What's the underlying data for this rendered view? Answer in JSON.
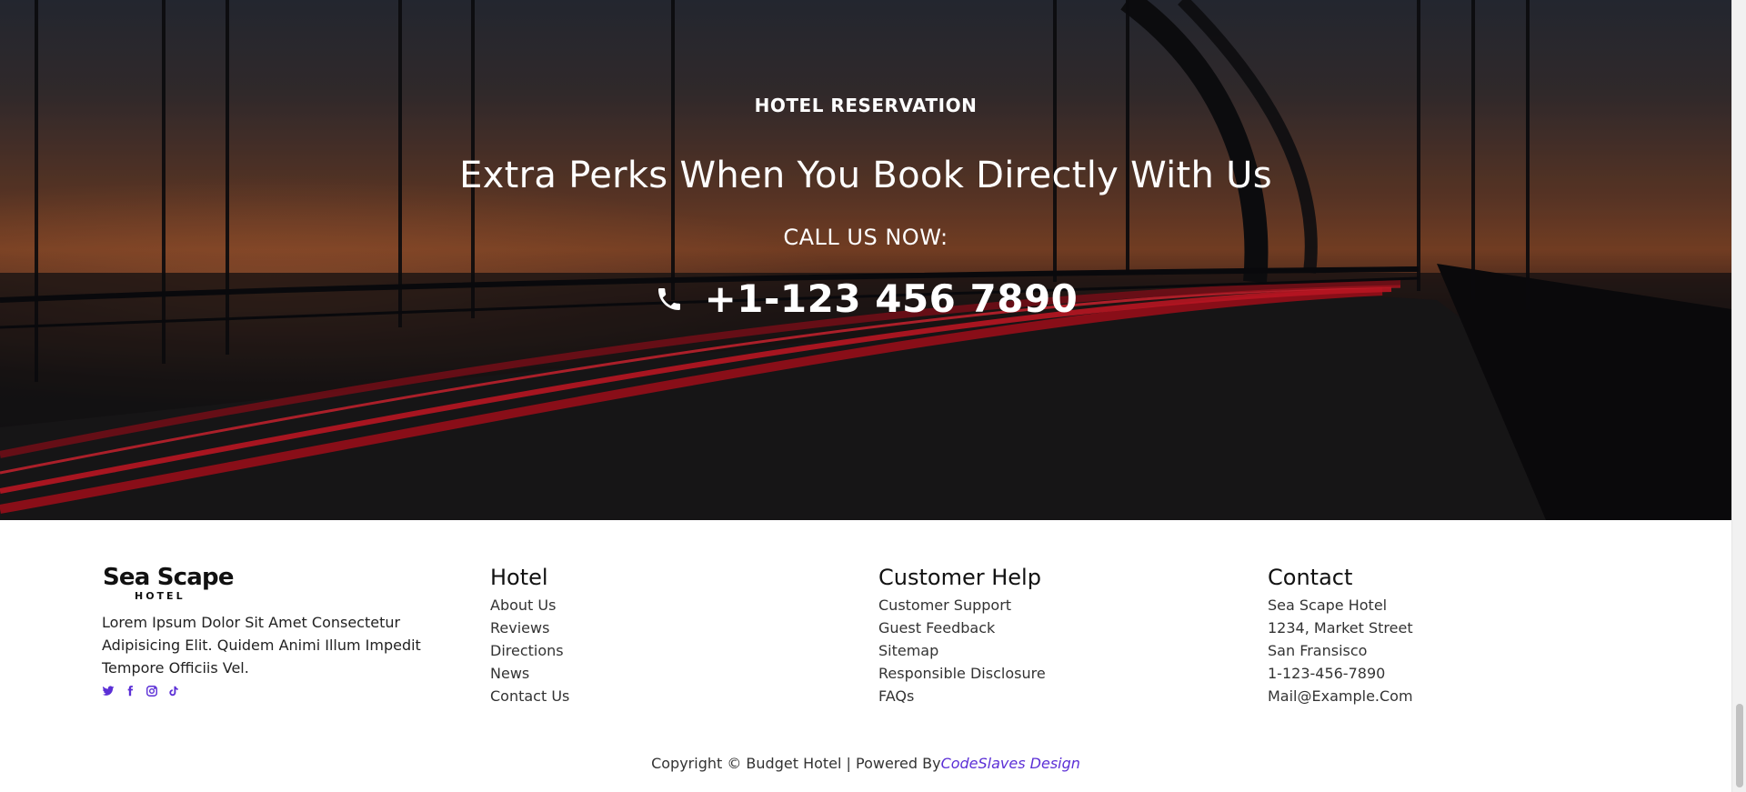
{
  "hero": {
    "eyebrow": "HOTEL RESERVATION",
    "headline": "Extra Perks When You Book Directly With Us",
    "call_label": "CALL US NOW:",
    "phone_icon": "phone-icon",
    "phone_number": "+1-123 456 7890"
  },
  "footer": {
    "brand": {
      "logo_main": "Sea Scape",
      "logo_sub": "HOTEL",
      "description": "Lorem Ipsum Dolor Sit Amet Consectetur Adipisicing Elit. Quidem Animi Illum Impedit Tempore Officiis Vel.",
      "social": [
        {
          "icon": "twitter-icon"
        },
        {
          "icon": "facebook-icon"
        },
        {
          "icon": "instagram-icon"
        },
        {
          "icon": "tiktok-icon"
        }
      ]
    },
    "hotel": {
      "title": "Hotel",
      "links": [
        "About Us",
        "Reviews",
        "Directions",
        "News",
        "Contact Us"
      ]
    },
    "customer_help": {
      "title": "Customer Help",
      "links": [
        "Customer Support",
        "Guest Feedback",
        "Sitemap",
        "Responsible Disclosure",
        "FAQs"
      ]
    },
    "contact": {
      "title": "Contact",
      "lines": [
        "Sea Scape Hotel",
        "1234, Market Street",
        "San Fransisco",
        "1-123-456-7890",
        "Mail@Example.Com"
      ]
    },
    "copyright": {
      "text": "Copyright © Budget Hotel | Powered By",
      "link": "CodeSlaves Design"
    }
  },
  "colors": {
    "accent": "#5b2fd6",
    "hero_text": "#ffffff",
    "footer_bg": "#ffffff"
  }
}
